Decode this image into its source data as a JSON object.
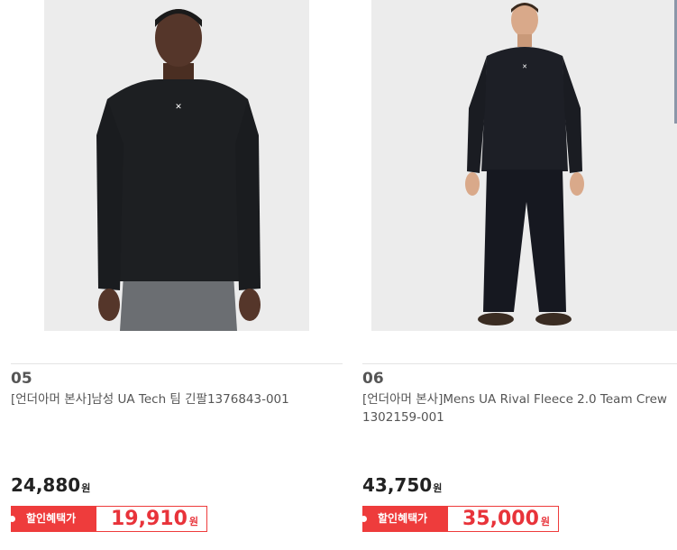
{
  "products": [
    {
      "rank": "05",
      "title": "[언더아머 본사]남성 UA Tech 팀 긴팔1376843-001",
      "price": "24,880",
      "won": "원",
      "coupon_label": "할인혜택가",
      "coupon_price": "19,910",
      "coupon_won": "원"
    },
    {
      "rank": "06",
      "title": "[언더아머 본사]Mens UA Rival Fleece 2.0 Team Crew 1302159-001",
      "price": "43,750",
      "won": "원",
      "coupon_label": "할인혜택가",
      "coupon_price": "35,000",
      "coupon_won": "원"
    }
  ],
  "colors": {
    "accent_red": "#ee3c3c",
    "image_bg": "#ececec"
  },
  "icons": {
    "product_1_image": "man-in-black-longsleeve-shirt",
    "product_2_image": "man-in-black-fleece-crew-and-pants"
  }
}
